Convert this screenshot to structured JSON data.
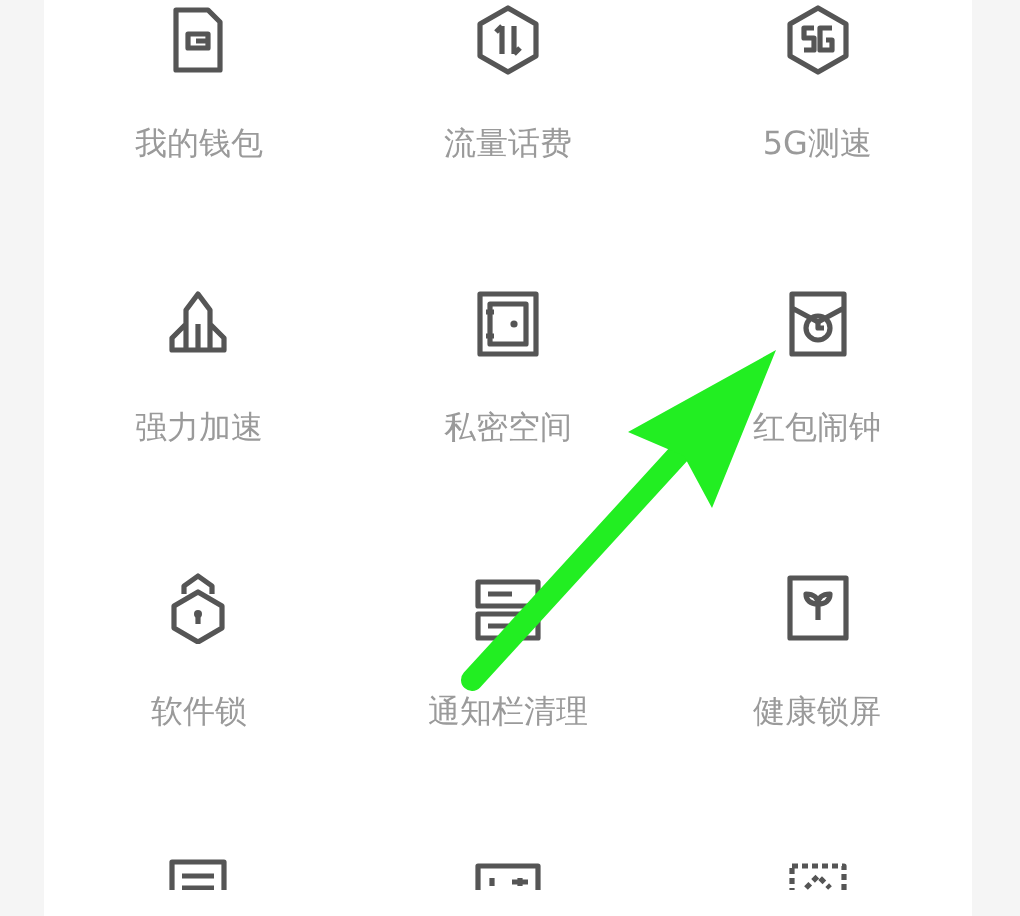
{
  "tools": [
    {
      "label": "我的钱包"
    },
    {
      "label": "流量话费"
    },
    {
      "label": "5G测速"
    },
    {
      "label": "强力加速"
    },
    {
      "label": "私密空间"
    },
    {
      "label": "红包闹钟"
    },
    {
      "label": "软件锁"
    },
    {
      "label": "通知栏清理"
    },
    {
      "label": "健康锁屏"
    }
  ]
}
